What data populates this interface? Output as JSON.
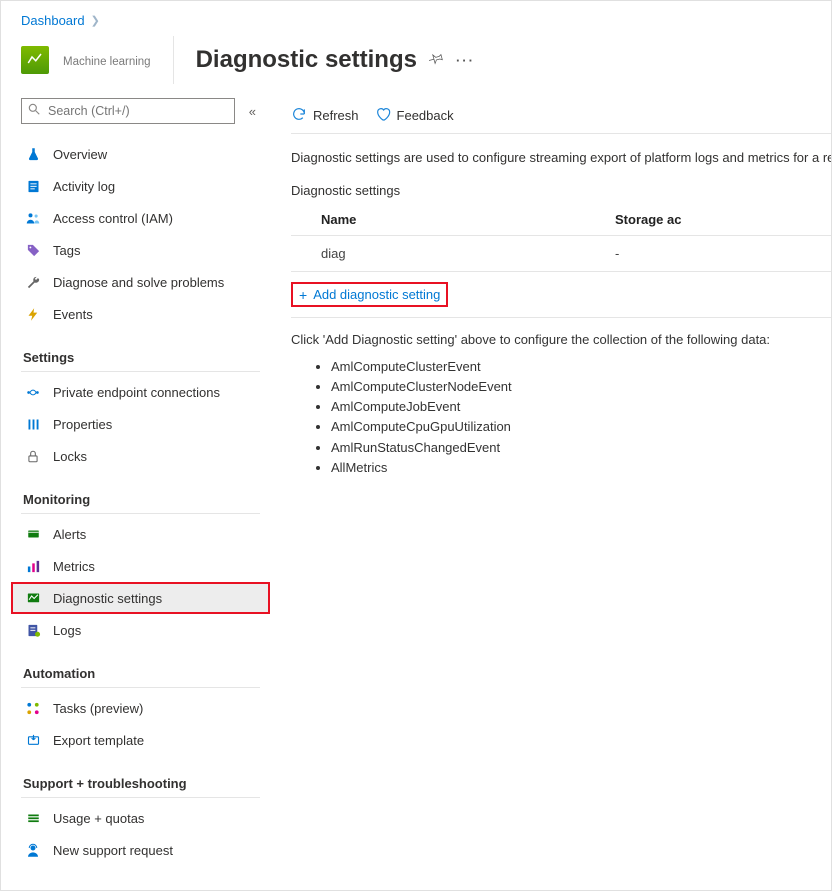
{
  "breadcrumb": {
    "dashboard": "Dashboard"
  },
  "header": {
    "service": "Machine learning",
    "title": "Diagnostic settings"
  },
  "search": {
    "placeholder": "Search (Ctrl+/)"
  },
  "sidebar": {
    "main": [
      {
        "label": "Overview"
      },
      {
        "label": "Activity log"
      },
      {
        "label": "Access control (IAM)"
      },
      {
        "label": "Tags"
      },
      {
        "label": "Diagnose and solve problems"
      },
      {
        "label": "Events"
      }
    ],
    "settings_h": "Settings",
    "settings": [
      {
        "label": "Private endpoint connections"
      },
      {
        "label": "Properties"
      },
      {
        "label": "Locks"
      }
    ],
    "monitor_h": "Monitoring",
    "monitor": [
      {
        "label": "Alerts"
      },
      {
        "label": "Metrics"
      },
      {
        "label": "Diagnostic settings"
      },
      {
        "label": "Logs"
      }
    ],
    "automation_h": "Automation",
    "automation": [
      {
        "label": "Tasks (preview)"
      },
      {
        "label": "Export template"
      }
    ],
    "support_h": "Support + troubleshooting",
    "support": [
      {
        "label": "Usage + quotas"
      },
      {
        "label": "New support request"
      }
    ]
  },
  "toolbar": {
    "refresh": "Refresh",
    "feedback": "Feedback"
  },
  "content": {
    "description": "Diagnostic settings are used to configure streaming export of platform logs and metrics for a re",
    "subheading": "Diagnostic settings",
    "table": {
      "headers": {
        "name": "Name",
        "storage": "Storage ac"
      },
      "rows": [
        {
          "name": "diag",
          "storage": "-"
        }
      ]
    },
    "add_label": "Add diagnostic setting",
    "hint": "Click 'Add Diagnostic setting' above to configure the collection of the following data:",
    "data_list": [
      "AmlComputeClusterEvent",
      "AmlComputeClusterNodeEvent",
      "AmlComputeJobEvent",
      "AmlComputeCpuGpuUtilization",
      "AmlRunStatusChangedEvent",
      "AllMetrics"
    ]
  }
}
